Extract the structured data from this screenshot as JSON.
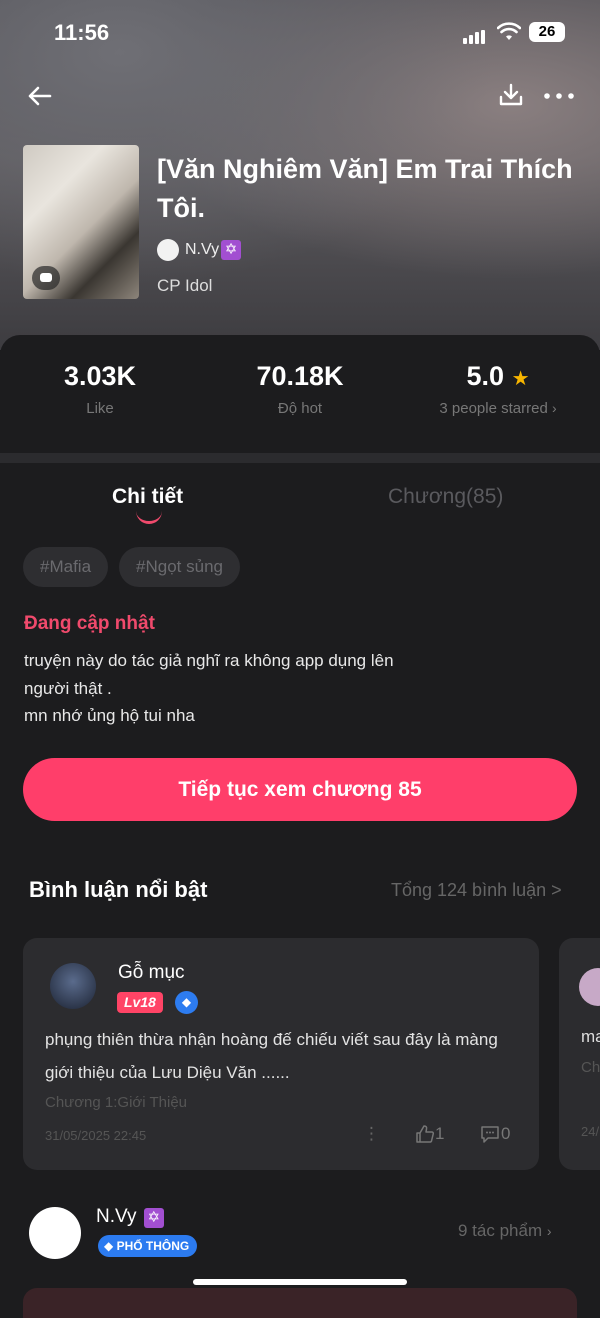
{
  "status_bar": {
    "time": "11:56",
    "battery": "26"
  },
  "story": {
    "title": "[Văn Nghiêm Văn] Em Trai Thích Tôi.",
    "author": "N.Vy",
    "category": "CP Idol"
  },
  "stats": {
    "likes": {
      "value": "3.03K",
      "label": "Like"
    },
    "hot": {
      "value": "70.18K",
      "label": "Độ hot"
    },
    "rating": {
      "value": "5.0",
      "label": "3 people starred"
    }
  },
  "tabs": {
    "detail": "Chi tiết",
    "chapters": "Chương(85)"
  },
  "tags": [
    "#Mafia",
    "#Ngọt sủng"
  ],
  "update_status": "Đang cập nhật",
  "description": [
    "truyện này do tác giả nghĩ ra không app dụng lên",
    "người thật .",
    "mn nhớ ủng hộ tui nha"
  ],
  "cta": "Tiếp tục xem chương 85",
  "comments_section": {
    "title": "Bình luận nổi bật",
    "total": "Tổng 124 bình luận >",
    "comment": {
      "user": "Gỗ mục",
      "level": "Lv18",
      "text": "phụng thiên thừa nhận hoàng đế chiếu viết sau đây là màng giới thiệu của Lưu Diệu Văn ......",
      "chapter": "Chương 1:Giới Thiệu",
      "date": "31/05/2025 22:45",
      "likes": "1",
      "replies": "0"
    },
    "peek": {
      "text": "ma",
      "chapter": "Ch",
      "date": "24/"
    }
  },
  "author_footer": {
    "name": "N.Vy",
    "badge": "PHỔ THÔNG",
    "works": "9 tác phẩm"
  },
  "colors": {
    "accent": "#ff3e6a",
    "panel": "#1c1c1e",
    "star": "#f7b500"
  }
}
